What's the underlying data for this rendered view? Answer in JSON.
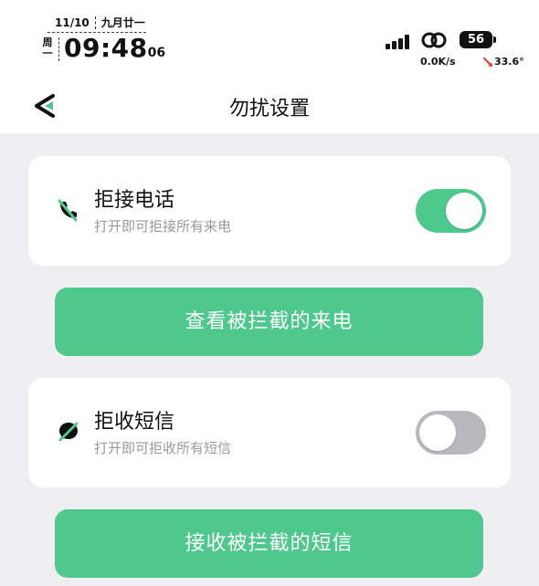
{
  "status_bar": {
    "date": "11/10",
    "lunar_date": "九月廿一",
    "weekday": "周一",
    "time": "09:48",
    "seconds": "06",
    "battery": "56",
    "net_speed": "0.0K/s",
    "temperature": "33.6°"
  },
  "header": {
    "title": "勿扰设置"
  },
  "calls": {
    "title": "拒接电话",
    "subtitle": "打开即可拒接所有来电",
    "enabled": true,
    "view_blocked_label": "查看被拦截的来电"
  },
  "sms": {
    "title": "拒收短信",
    "subtitle": "打开即可拒收所有短信",
    "enabled": false,
    "view_blocked_label": "接收被拦截的短信"
  },
  "colors": {
    "accent": "#4fc88d",
    "toggle_off": "#b9b9bd",
    "background": "#efeff2"
  }
}
